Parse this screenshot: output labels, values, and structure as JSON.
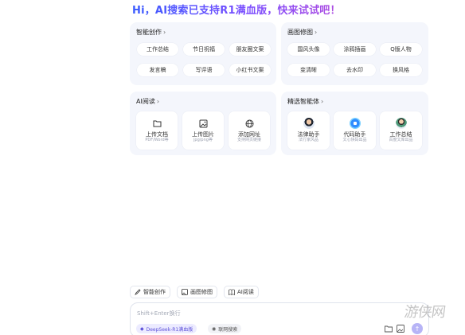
{
  "headline": "Hi，AI搜索已支持R1满血版，快来试试吧！",
  "cards": {
    "writing": {
      "title": "智能创作",
      "chips": [
        "工作总结",
        "节日祝福",
        "朋友圈文案",
        "发言稿",
        "写评语",
        "小红书文案"
      ]
    },
    "image_edit": {
      "title": "画图修图",
      "chips": [
        "国风头像",
        "涂鸦插画",
        "Q版人物",
        "变清晰",
        "去水印",
        "换风格"
      ]
    },
    "ai_reading": {
      "title": "AI阅读",
      "tiles": [
        {
          "label": "上传文档",
          "sub": "PDF/Word等",
          "icon": "folder-icon"
        },
        {
          "label": "上传图片",
          "sub": "jpg/png等",
          "icon": "image-icon"
        },
        {
          "label": "添加网址",
          "sub": "支持网页链接",
          "icon": "globe-icon"
        }
      ]
    },
    "agents": {
      "title": "精选智能体",
      "tiles": [
        {
          "label": "法律助手",
          "sub": "法行家风品",
          "icon": "lawyer-avatar"
        },
        {
          "label": "代码助手",
          "sub": "文心快码出品",
          "icon": "code-avatar"
        },
        {
          "label": "工作总结",
          "sub": "百度文库出品",
          "icon": "worker-avatar"
        }
      ]
    }
  },
  "actions": [
    "智能创作",
    "画图修图",
    "AI阅读"
  ],
  "input": {
    "placeholder": "Shift+Enter换行",
    "model_pill": "DeepSeek-R1满血版",
    "search_pill": "联网搜索"
  },
  "watermark": "游侠网",
  "colors": {
    "accent": "#5b4fd9",
    "card_bg": "#f4f6fc",
    "send_button": "#b7b4f6"
  }
}
